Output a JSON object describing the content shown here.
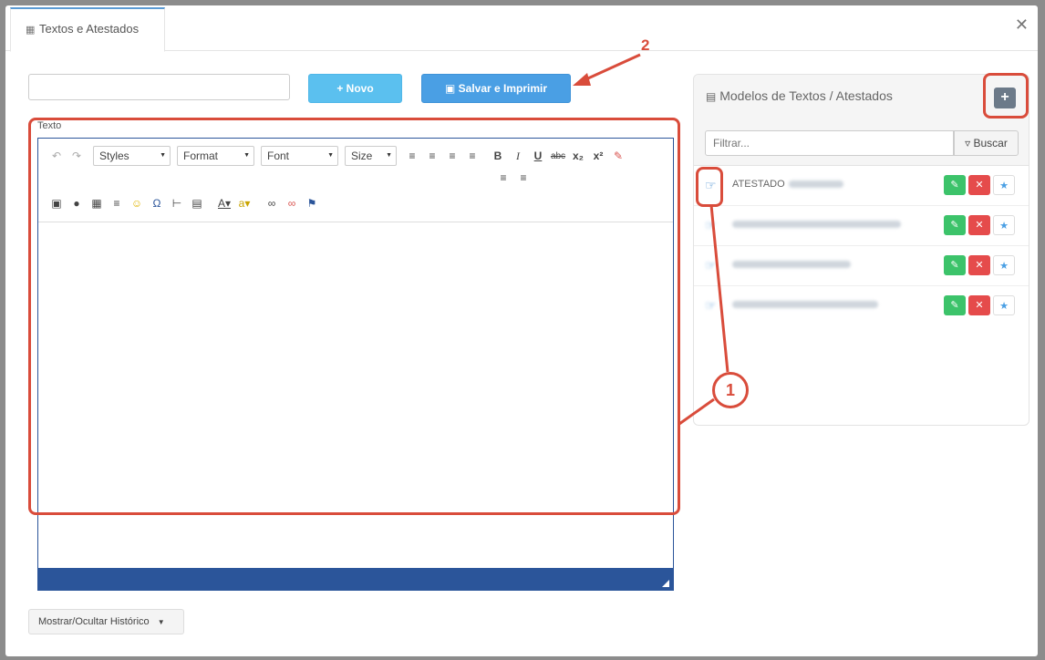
{
  "tab": {
    "label": "Textos e Atestados"
  },
  "toolbar": {
    "novo_label": "+ Novo",
    "save_label": "Salvar e Imprimir"
  },
  "editor": {
    "label": "Texto",
    "combos": [
      "Styles",
      "Format",
      "Font",
      "Size"
    ]
  },
  "history_button": {
    "label": "Mostrar/Ocultar Histórico"
  },
  "panel": {
    "title": "Modelos de Textos / Atestados",
    "filter_placeholder": "Filtrar...",
    "buscar_label": "Buscar",
    "items": [
      {
        "label": "ATESTADO"
      },
      {
        "label": ""
      },
      {
        "label": ""
      },
      {
        "label": ""
      }
    ]
  },
  "annotations": {
    "callout_1": "1",
    "callout_2": "2"
  },
  "colors": {
    "accent": "#d94c3b",
    "editor_border": "#2b559a",
    "novo": "#5bc0ef",
    "save": "#4a9fe4"
  }
}
